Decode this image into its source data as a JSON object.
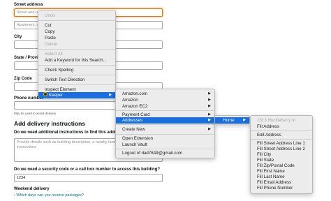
{
  "form": {
    "street_label": "Street address",
    "street_placeholder": "Street and number, P.O. box, c/o.",
    "apt_placeholder": "Apartment, suite, unit, building, floor, etc.",
    "city_label": "City",
    "state_label": "State / Province / Region",
    "zip_label": "Zip Code",
    "phone_label": "Phone number",
    "phone_hint": "May be used to assist delivery",
    "delivery_title": "Add delivery instructions",
    "instructions_question": "Do we need additional instructions to find this address?",
    "instructions_placeholder": "Provide details such as building description, a nearby landmark, or other navigation instructions",
    "security_question": "Do we need a security code or a call box number to access this building?",
    "security_value": "1234",
    "weekend_label": "Weekend delivery",
    "weekend_link": "› Which days can you receive packages?"
  },
  "context_menu": {
    "items": [
      "Undo",
      "Cut",
      "Copy",
      "Paste",
      "Delete",
      "Select All",
      "Add a Keyword for this Search...",
      "Check Spelling",
      "Switch Text Direction",
      "Inspect Element",
      "Keeper"
    ]
  },
  "keeper_menu": {
    "items": [
      "Amazon.com",
      "Amazon",
      "Amazon EC2",
      "Payment Card",
      "Addresses",
      "Create New",
      "Open Extension",
      "Launch Vault",
      "Logout of dad7849@gmail.com"
    ]
  },
  "addresses_menu": {
    "items": [
      "Home"
    ]
  },
  "home_menu": {
    "items": [
      "1313 Huckleberry In",
      "Fill Address",
      "Edit Address",
      "Fill Street Address Line 1",
      "Fill Street Address Line 2",
      "Fill City",
      "Fill State",
      "Fill Zip/Postal Code",
      "Fill First Name",
      "Fill Last Name",
      "Fill Email Address",
      "Fill Phone Number"
    ]
  },
  "colors": {
    "highlight": "#1a6fe0",
    "focus_ring": "#e77600",
    "link": "#007185"
  },
  "icons": {
    "submenu_arrow": "▶",
    "keeper": "keeper-logo-icon"
  }
}
